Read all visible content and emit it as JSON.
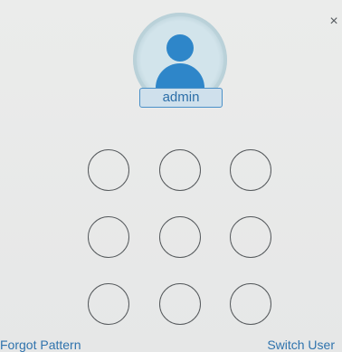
{
  "dialog": {
    "close_icon": "×"
  },
  "user": {
    "name": "admin",
    "avatar_icon": "person-icon"
  },
  "pattern": {
    "rows": 3,
    "cols": 3
  },
  "footer": {
    "forgot_label": "Forgot Pattern",
    "switch_label": "Switch User"
  },
  "colors": {
    "accent": "#2e86c9",
    "link": "#2f73ad",
    "node_border": "#55595c"
  }
}
